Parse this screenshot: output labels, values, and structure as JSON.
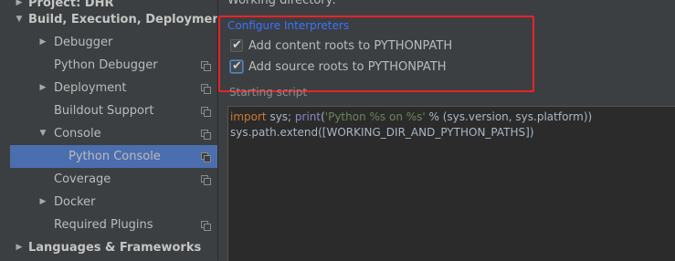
{
  "tree": {
    "items": [
      {
        "label": "Project: DHR",
        "bold": true,
        "arrow": "▶",
        "indent": 0,
        "copy": false,
        "selected": false
      },
      {
        "label": "Build, Execution, Deployment",
        "bold": true,
        "arrow": "▼",
        "indent": 0,
        "copy": false,
        "selected": false
      },
      {
        "label": "Debugger",
        "bold": false,
        "arrow": "▶",
        "indent": 1,
        "copy": false,
        "selected": false
      },
      {
        "label": "Python Debugger",
        "bold": false,
        "arrow": "",
        "indent": 1,
        "copy": true,
        "selected": false
      },
      {
        "label": "Deployment",
        "bold": false,
        "arrow": "▶",
        "indent": 1,
        "copy": true,
        "selected": false
      },
      {
        "label": "Buildout Support",
        "bold": false,
        "arrow": "",
        "indent": 1,
        "copy": true,
        "selected": false
      },
      {
        "label": "Console",
        "bold": false,
        "arrow": "▼",
        "indent": 1,
        "copy": true,
        "selected": false
      },
      {
        "label": "Python Console",
        "bold": false,
        "arrow": "",
        "indent": 2,
        "copy": true,
        "selected": true
      },
      {
        "label": "Coverage",
        "bold": false,
        "arrow": "",
        "indent": 1,
        "copy": true,
        "selected": false
      },
      {
        "label": "Docker",
        "bold": false,
        "arrow": "▶",
        "indent": 1,
        "copy": false,
        "selected": false
      },
      {
        "label": "Required Plugins",
        "bold": false,
        "arrow": "",
        "indent": 1,
        "copy": true,
        "selected": false
      },
      {
        "label": "Languages & Frameworks",
        "bold": true,
        "arrow": "▶",
        "indent": 0,
        "copy": false,
        "selected": false
      }
    ]
  },
  "settings": {
    "working_directory_label": "Working directory:",
    "configure_interpreters_link": "Configure Interpreters",
    "add_content_roots_label": "Add content roots to PYTHONPATH",
    "add_content_roots_checked": true,
    "add_source_roots_label": "Add source roots to PYTHONPATH",
    "add_source_roots_checked": true,
    "starting_script_label": "Starting script"
  },
  "editor": {
    "line1": {
      "kw_import": "import",
      "mod": " sys; ",
      "fn_print": "print",
      "paren_open": "(",
      "str": "'Python %s on %s'",
      "rest": " % (sys.version, sys.platform))"
    },
    "line2": "sys.path.extend([WORKING_DIR_AND_PYTHON_PATHS])"
  },
  "colors": {
    "selection": "#4b6eaf",
    "link": "#3b73ff",
    "highlight_box": "#e8232a",
    "keyword": "#cc7832",
    "builtin": "#8888c6",
    "string": "#6a8759"
  }
}
